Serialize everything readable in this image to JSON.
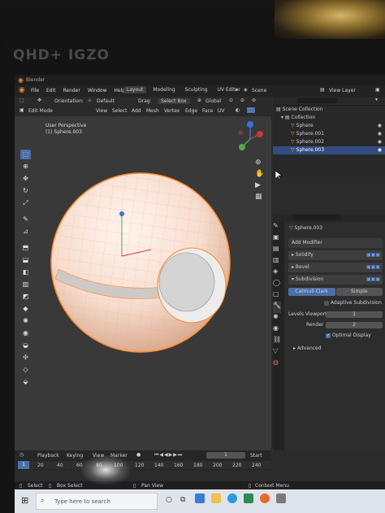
{
  "bezel": {
    "brand": "QHD+ IGZO"
  },
  "title_bar": {
    "app": "Blender"
  },
  "menu": [
    "File",
    "Edit",
    "Render",
    "Window",
    "Help"
  ],
  "workspace_tabs": [
    "Layout",
    "Modeling",
    "Sculpting",
    "UV Editor"
  ],
  "scene_label": "Scene",
  "view_layer_label": "View Layer",
  "header": {
    "orientation_label": "Orientation:",
    "orientation_value": "Default",
    "drag_label": "Drag:",
    "drag_value": "Select Box",
    "transform_space": "Global"
  },
  "mode_bar": {
    "mode": "Edit Mode",
    "items": [
      "View",
      "Select",
      "Add",
      "Mesh",
      "Vertex",
      "Edge",
      "Face",
      "UV"
    ]
  },
  "viewport": {
    "overlay_line1": "User Perspective",
    "overlay_line2": "(1) Sphere.003"
  },
  "outliner": {
    "items": [
      "Scene Collection",
      "Collection",
      "Sphere",
      "Sphere.001",
      "Sphere.002",
      "Sphere.003"
    ]
  },
  "properties": {
    "object_name": "Sphere.003",
    "add_modifier": "Add Modifier",
    "modifiers": [
      "Solidify",
      "Bevel",
      "Subdivision"
    ],
    "subdivision": {
      "type_options": [
        "Catmull-Clark",
        "Simple"
      ],
      "adaptive_label": "Adaptive Subdivision",
      "levels_viewport_label": "Levels Viewport",
      "levels_viewport_value": "1",
      "render_label": "Render",
      "render_value": "2",
      "optimal_display_label": "Optimal Display",
      "advanced_label": "Advanced"
    }
  },
  "timeline": {
    "menu": [
      "Playback",
      "Keying",
      "View",
      "Marker"
    ],
    "current_frame": "1",
    "start_label": "Start",
    "ruler": [
      "1",
      "20",
      "40",
      "60",
      "80",
      "100",
      "120",
      "140",
      "160",
      "180",
      "200",
      "220",
      "240"
    ]
  },
  "status_bar": {
    "select": "Select",
    "box_select": "Box Select",
    "pan_view": "Pan View",
    "context_menu": "Context Menu"
  },
  "taskbar": {
    "search_placeholder": "Type here to search"
  },
  "colors": {
    "accent": "#4a70a8",
    "sphere": "#f6ddcf",
    "wire": "#ff8a2a"
  }
}
